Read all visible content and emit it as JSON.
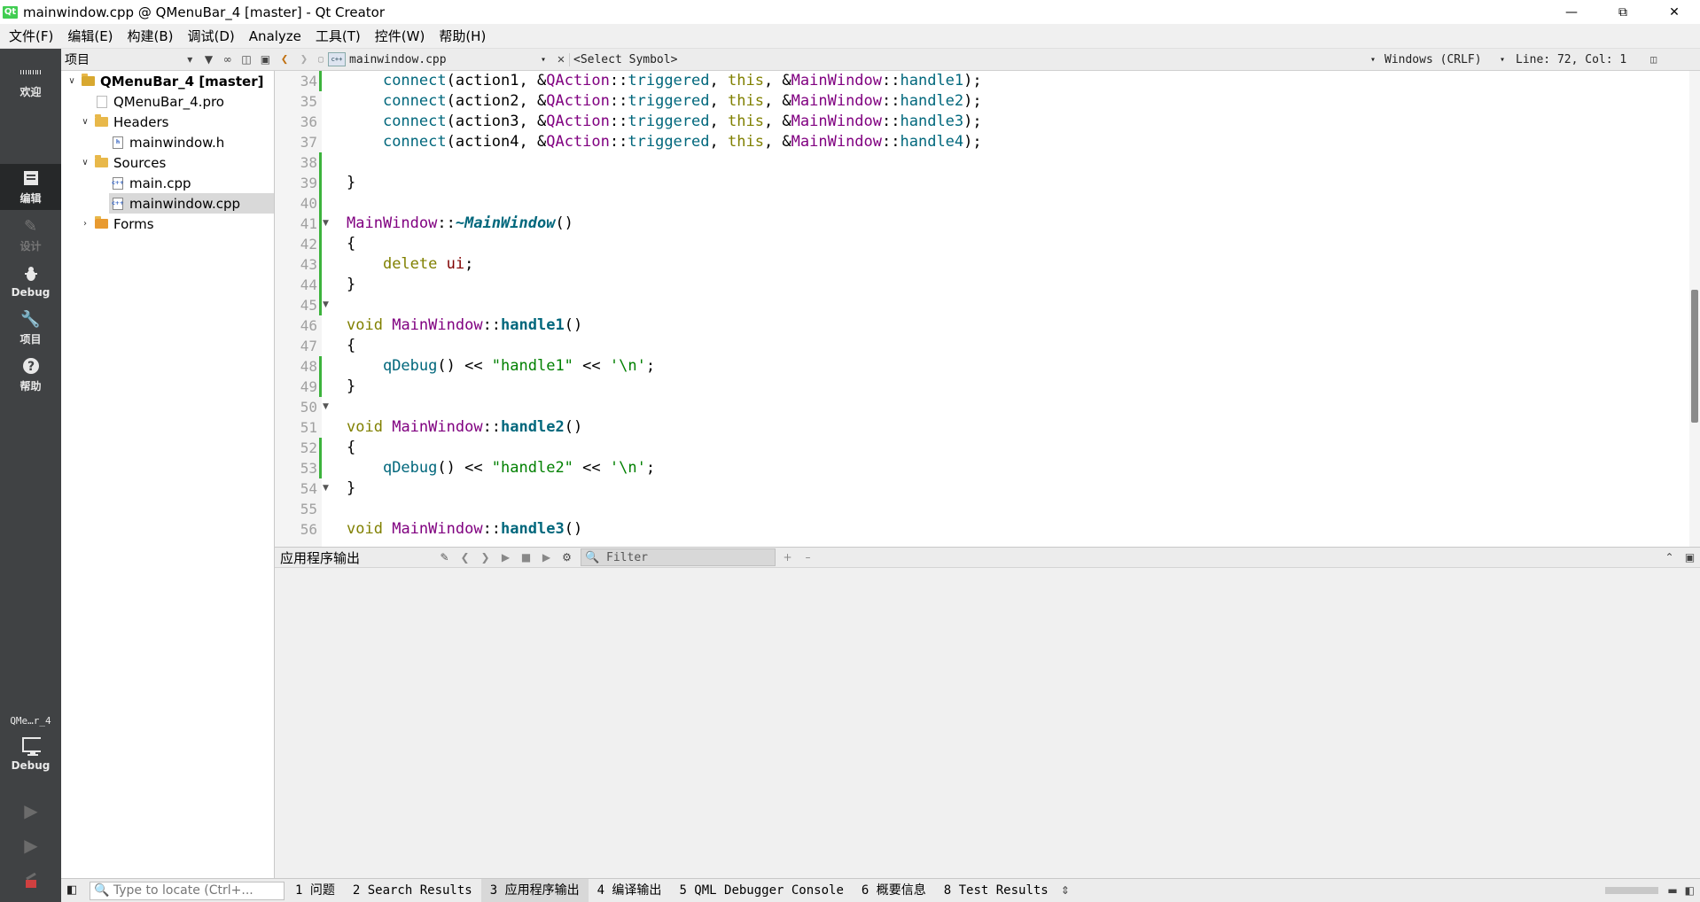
{
  "window": {
    "title": "mainwindow.cpp @ QMenuBar_4 [master] - Qt Creator",
    "logo": "Qt"
  },
  "menubar": [
    "文件(F)",
    "编辑(E)",
    "构建(B)",
    "调试(D)",
    "Analyze",
    "工具(T)",
    "控件(W)",
    "帮助(H)"
  ],
  "modes": [
    {
      "label": "欢迎",
      "icon": "grid-icon"
    },
    {
      "label": "编辑",
      "icon": "edit-doc-icon"
    },
    {
      "label": "设计",
      "icon": "pencil-icon"
    },
    {
      "label": "Debug",
      "icon": "bug-icon"
    },
    {
      "label": "项目",
      "icon": "wrench-icon"
    },
    {
      "label": "帮助",
      "icon": "help-icon"
    }
  ],
  "kit": {
    "project": "QMe…r_4",
    "config": "Debug"
  },
  "project_panel": {
    "title": "项目",
    "tree": [
      {
        "label": "QMenuBar_4 [master]"
      },
      {
        "label": "QMenuBar_4.pro"
      },
      {
        "label": "Headers"
      },
      {
        "label": "mainwindow.h"
      },
      {
        "label": "Sources"
      },
      {
        "label": "main.cpp"
      },
      {
        "label": "mainwindow.cpp"
      },
      {
        "label": "Forms"
      }
    ]
  },
  "editor_toolbar": {
    "file": "mainwindow.cpp",
    "symbol": "<Select Symbol>",
    "line_ending": "Windows (CRLF)",
    "position": "Line: 72, Col: 1"
  },
  "editor": {
    "line_numbers": [
      "34",
      "35",
      "36",
      "37",
      "38",
      "39",
      "40",
      "41",
      "42",
      "43",
      "44",
      "45",
      "46",
      "47",
      "48",
      "49",
      "50",
      "51",
      "52",
      "53",
      "54",
      "55",
      "56"
    ],
    "code": {
      "l34": {
        "a": "action1",
        "c": "handle1"
      },
      "l35": {
        "a": "action2",
        "c": "handle2"
      },
      "l36": {
        "a": "action3",
        "c": "handle3"
      },
      "l37": {
        "a": "action4",
        "c": "handle4"
      },
      "tok": {
        "connect": "connect",
        "qaction": "QAction",
        "triggered": "triggered",
        "this": "this",
        "mainwindow": "MainWindow",
        "dtor": "~MainWindow",
        "delete": "delete",
        "ui": "ui",
        "void": "void",
        "qdebug": "qDebug",
        "s1": "\"handle1\"",
        "s2": "\"handle2\"",
        "nl": "'\\n'",
        "h1": "handle1",
        "h2": "handle2",
        "h3": "handle3"
      }
    }
  },
  "output_pane": {
    "title": "应用程序输出",
    "filter_placeholder": "Filter"
  },
  "statusbar": {
    "locate_placeholder": "Type to locate (Ctrl+...",
    "tabs": [
      "1 问题",
      "2 Search Results",
      "3 应用程序输出",
      "4 编译输出",
      "5 QML Debugger Console",
      "6 概要信息",
      "8 Test Results"
    ],
    "active_tab": "3 应用程序输出"
  }
}
